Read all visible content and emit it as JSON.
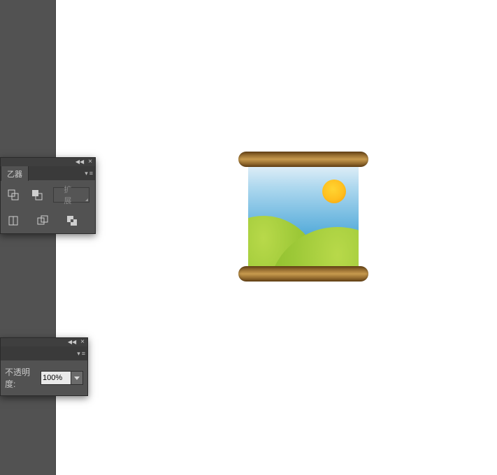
{
  "pathfinder_panel": {
    "tab_partial": "乙器",
    "expand_button": "扩展"
  },
  "transparency_panel": {
    "opacity_label": "不透明度:",
    "opacity_value": "100%"
  }
}
